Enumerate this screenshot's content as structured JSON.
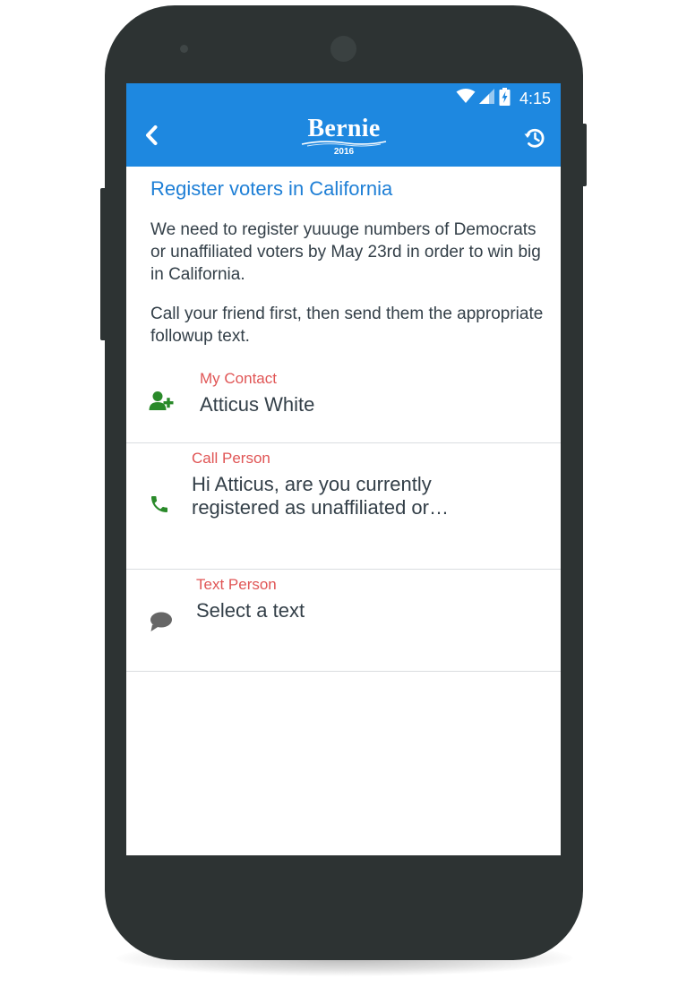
{
  "status_bar": {
    "time": "4:15",
    "icons": [
      "wifi-icon",
      "signal-icon",
      "battery-charging-icon"
    ]
  },
  "app_bar": {
    "back_icon": "chevron-left-icon",
    "logo_text": "Bernie",
    "logo_year": "2016",
    "history_icon": "history-icon",
    "background_color": "#1e88e0"
  },
  "content": {
    "title": "Register voters in California",
    "paragraphs": [
      "We need to register yuuuge numbers of Democrats or unaffiliated voters by May 23rd in order to win big in California.",
      "Call your friend first, then send them the appropriate followup text."
    ],
    "rows": [
      {
        "icon": "add-contact-icon",
        "icon_color": "#2a8a2a",
        "label": "My Contact",
        "value": "Atticus White"
      },
      {
        "icon": "phone-icon",
        "icon_color": "#2a8a2a",
        "label": "Call Person",
        "value": "Hi Atticus, are you currently registered as unaffiliated or…"
      },
      {
        "icon": "chat-bubble-icon",
        "icon_color": "#666666",
        "label": "Text Person",
        "value": "Select a text"
      }
    ]
  }
}
